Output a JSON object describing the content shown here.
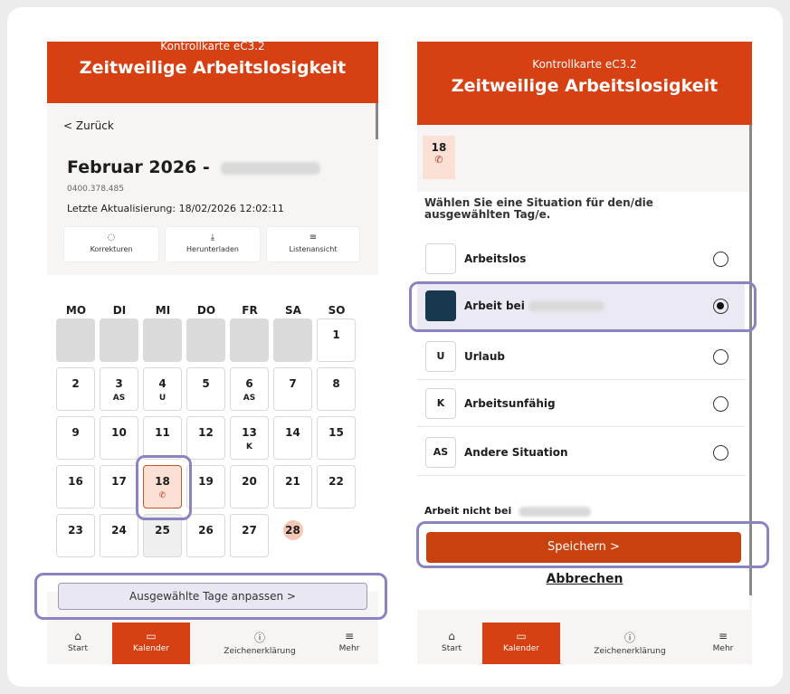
{
  "left": {
    "header_sub": "Kontrollkarte eC3.2",
    "header_title": "Zeitweilige Arbeitslosigkeit",
    "back_label": "< Zurück",
    "month": "Februar 2026 -",
    "id_number": "0400.378.485",
    "last_update": "Letzte Aktualisierung: 18/02/2026 12:02:11",
    "tools": [
      {
        "label": "Korrekturen",
        "icon": "chat-icon",
        "glyph": "◌"
      },
      {
        "label": "Herunterladen",
        "icon": "download-icon",
        "glyph": "⤓"
      },
      {
        "label": "Listenansicht",
        "icon": "list-icon",
        "glyph": "≡"
      }
    ],
    "weekdays": [
      "MO",
      "DI",
      "MI",
      "DO",
      "FR",
      "SA",
      "SO"
    ],
    "days": [
      {
        "n": "1",
        "badge": ""
      },
      {
        "n": "2",
        "badge": ""
      },
      {
        "n": "3",
        "badge": "AS"
      },
      {
        "n": "4",
        "badge": "U"
      },
      {
        "n": "5",
        "badge": ""
      },
      {
        "n": "6",
        "badge": "AS"
      },
      {
        "n": "7",
        "badge": ""
      },
      {
        "n": "8",
        "badge": ""
      },
      {
        "n": "9",
        "badge": ""
      },
      {
        "n": "10",
        "badge": ""
      },
      {
        "n": "11",
        "badge": ""
      },
      {
        "n": "12",
        "badge": ""
      },
      {
        "n": "13",
        "badge": "K"
      },
      {
        "n": "14",
        "badge": ""
      },
      {
        "n": "15",
        "badge": ""
      },
      {
        "n": "16",
        "badge": ""
      },
      {
        "n": "17",
        "badge": ""
      },
      {
        "n": "18",
        "badge": "phone"
      },
      {
        "n": "19",
        "badge": ""
      },
      {
        "n": "20",
        "badge": ""
      },
      {
        "n": "21",
        "badge": ""
      },
      {
        "n": "22",
        "badge": ""
      },
      {
        "n": "23",
        "badge": ""
      },
      {
        "n": "24",
        "badge": ""
      },
      {
        "n": "25",
        "badge": ""
      },
      {
        "n": "26",
        "badge": ""
      },
      {
        "n": "27",
        "badge": ""
      },
      {
        "n": "28",
        "badge": ""
      }
    ],
    "adjust_button": "Ausgewählte Tage anpassen  >"
  },
  "right": {
    "header_sub": "Kontrollkarte eC3.2",
    "header_title": "Zeitweilige Arbeitslosigkeit",
    "selected_day": "18",
    "prompt": "Wählen Sie eine Situation für den/die ausgewählten Tag/e.",
    "options": [
      {
        "code": "",
        "label": "Arbeitslos",
        "selected": false
      },
      {
        "code": "",
        "label": "Arbeit bei",
        "selected": true
      },
      {
        "code": "U",
        "label": "Urlaub",
        "selected": false
      },
      {
        "code": "K",
        "label": "Arbeitsunfähig",
        "selected": false
      },
      {
        "code": "AS",
        "label": "Andere Situation",
        "selected": false
      }
    ],
    "not_at_label": "Arbeit nicht bei",
    "save_button": "Speichern  >",
    "cancel_link": "Abbrechen"
  },
  "nav": [
    {
      "label": "Start",
      "icon": "home-icon",
      "glyph": "⌂"
    },
    {
      "label": "Kalender",
      "icon": "calendar-icon",
      "glyph": "▭"
    },
    {
      "label": "Zeichenerklärung",
      "icon": "info-icon",
      "glyph": "ⓘ"
    },
    {
      "label": "Mehr",
      "icon": "menu-icon",
      "glyph": "≡"
    }
  ],
  "colors": {
    "brand": "#d64012",
    "selection": "#8a84c2",
    "dark_code": "#17384e"
  }
}
